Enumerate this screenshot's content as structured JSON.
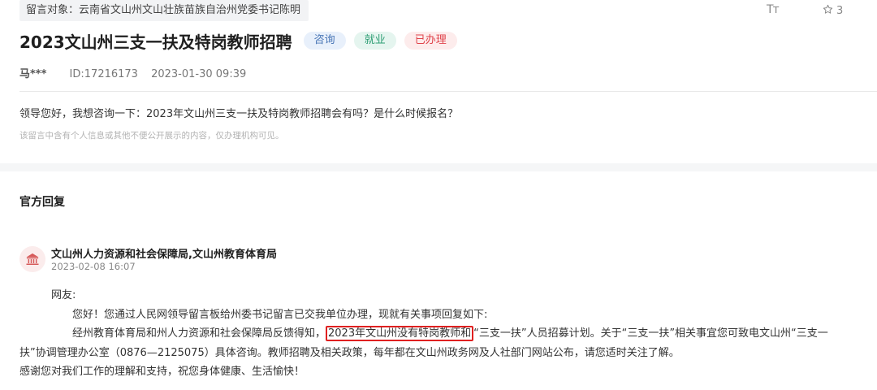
{
  "message": {
    "target_label": "留言对象：",
    "target_value": "云南省文山州文山壮族苗族自治州党委书记陈明",
    "title": "2023文山州三支一扶及特岗教师招聘",
    "tags": [
      "咨询",
      "就业",
      "已办理"
    ],
    "author": "马***",
    "id": "ID:17216173",
    "datetime": "2023-01-30 09:39",
    "question": "领导您好，我想咨询一下：2023年文山州三支一扶及特岗教师招聘会有吗？是什么时候报名？",
    "privacy_note": "该留言中含有个人信息或其他不便公开展示的内容，仅办理机构可见。"
  },
  "toolbar": {
    "font_icon": "Tт",
    "star_count": "3"
  },
  "reply": {
    "heading": "官方回复",
    "org": "文山州人力资源和社会保障局,文山州教育体育局",
    "date": "2023-02-08 16:07",
    "greeting": "网友:",
    "para1": "您好！您通过人民网领导留言板给州委书记留言已交我单位办理，现就有关事项回复如下:",
    "para2_before": "经州教育体育局和州人力资源和社会保障局反馈得知，",
    "para2_highlight": "2023年文山州没有特岗教师和",
    "para2_after": "“三支一扶”人员招募计划。关于“三支一扶”相关事宜您可致电文山州“三支一",
    "para2_cont": "扶”协调管理办公室（0876—2125075）具体咨询。教师招聘及相关政策，每年都在文山州政务网及人社部门网站公布，请您适时关注了解。",
    "closing": "感谢您对我们工作的理解和支持，祝您身体健康、生活愉快！"
  },
  "icons": {
    "font_size": "font-size-icon",
    "star": "star-icon",
    "org": "government-building-icon"
  },
  "colors": {
    "tag_consult": "#4a77b7",
    "tag_employ": "#2e9e74",
    "tag_done": "#e0434b",
    "highlight_box": "#e02020"
  }
}
